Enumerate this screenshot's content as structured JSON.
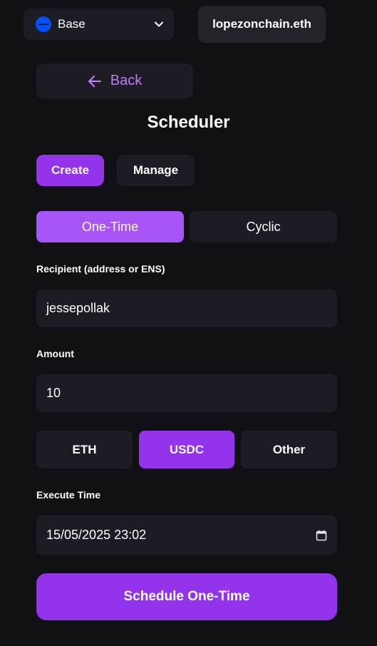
{
  "network": {
    "name": "Base",
    "icon": "base-network-icon",
    "accent": "#0052ff"
  },
  "account": {
    "label": "lopezonchain.eth"
  },
  "back": {
    "label": "Back",
    "icon": "arrow-left-icon",
    "color": "#c27bf6"
  },
  "page": {
    "title": "Scheduler"
  },
  "tabs": [
    {
      "label": "Create",
      "active": true
    },
    {
      "label": "Manage",
      "active": false
    }
  ],
  "modes": [
    {
      "label": "One-Time",
      "active": true
    },
    {
      "label": "Cyclic",
      "active": false
    }
  ],
  "form": {
    "recipient_label": "Recipient (address or ENS)",
    "recipient_value": "jessepollak",
    "amount_label": "Amount",
    "amount_value": "10",
    "tokens": [
      {
        "label": "ETH",
        "selected": false
      },
      {
        "label": "USDC",
        "selected": true
      },
      {
        "label": "Other",
        "selected": false
      }
    ],
    "execute_label": "Execute Time",
    "execute_value": "15/05/2025 23:02",
    "calendar_icon": "calendar-icon"
  },
  "submit": {
    "label": "Schedule One-Time"
  },
  "colors": {
    "background": "#111015",
    "surface": "#1d1c24",
    "primary": "#9333ea",
    "primary_light": "#a855f7"
  }
}
